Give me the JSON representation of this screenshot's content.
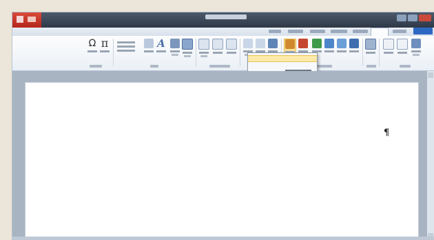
{
  "document": {
    "paragraph_mark": "¶"
  },
  "colors": {
    "title_bar": "#2e3847",
    "quick_access": "#b3261d",
    "ribbon": "#eaf0f6",
    "dropdown_highlight": "#fbe9a8",
    "page": "#ffffff",
    "workspace": "#a9b4c3"
  },
  "icons": [
    "omega-symbol-icon",
    "pi-equation-icon",
    "wordart-icon",
    "text-box-icon",
    "header-icon",
    "footer-icon",
    "page-number-icon",
    "chart-icon",
    "smartart-icon",
    "shapes-icon",
    "picture-icon",
    "table-icon",
    "page-break-icon",
    "cover-page-icon"
  ]
}
